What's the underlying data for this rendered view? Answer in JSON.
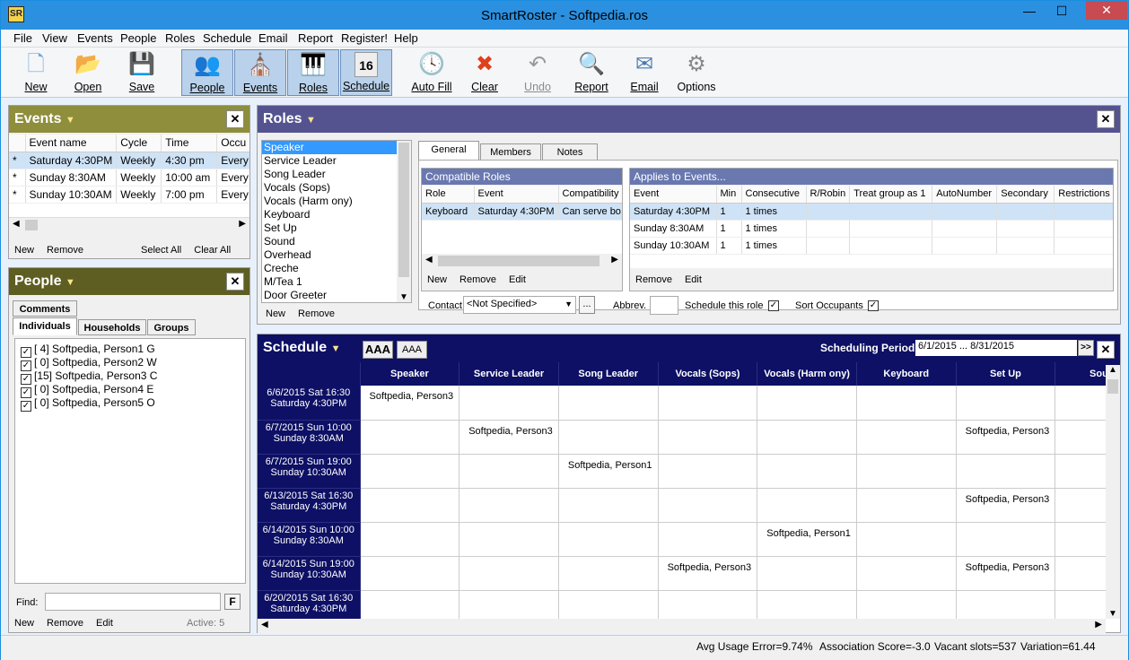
{
  "app": {
    "title": "SmartRoster - Softpedia.ros",
    "icon_text": "SR"
  },
  "menu": [
    "File",
    "View",
    "Events",
    "People",
    "Roles",
    "Schedule",
    "Email",
    "Report",
    "Register!",
    "Help"
  ],
  "toolbar": [
    {
      "label": "New",
      "icon": "new-file-icon",
      "glyph": "🗋"
    },
    {
      "label": "Open",
      "icon": "open-folder-icon",
      "glyph": "📂"
    },
    {
      "label": "Save",
      "icon": "save-disk-icon",
      "glyph": "💾"
    },
    {
      "label": "People",
      "icon": "people-icon",
      "glyph": "👥"
    },
    {
      "label": "Events",
      "icon": "events-building-icon",
      "glyph": "⛪"
    },
    {
      "label": "Roles",
      "icon": "roles-piano-icon",
      "glyph": "🎹"
    },
    {
      "label": "Schedule",
      "icon": "schedule-calendar-icon",
      "glyph": "16"
    },
    {
      "label": "Auto Fill",
      "icon": "clock-icon",
      "glyph": "🕓"
    },
    {
      "label": "Clear",
      "icon": "clear-x-icon",
      "glyph": "✖"
    },
    {
      "label": "Undo",
      "icon": "undo-icon",
      "glyph": "↶"
    },
    {
      "label": "Report",
      "icon": "report-icon",
      "glyph": "🔍"
    },
    {
      "label": "Email",
      "icon": "email-icon",
      "glyph": "✉"
    },
    {
      "label": "Options",
      "icon": "gear-icon",
      "glyph": "⚙"
    }
  ],
  "events": {
    "title": "Events",
    "headers": [
      "Event name",
      "Cycle",
      "Time",
      "Occu"
    ],
    "rows": [
      [
        "*",
        "Saturday 4:30PM",
        "Weekly",
        "4:30 pm",
        "Every"
      ],
      [
        "*",
        "Sunday 8:30AM",
        "Weekly",
        "10:00 am",
        "Every"
      ],
      [
        "*",
        "Sunday 10:30AM",
        "Weekly",
        "7:00 pm",
        "Every"
      ]
    ],
    "actions": [
      "New",
      "Remove",
      "Select All",
      "Clear All"
    ]
  },
  "people": {
    "title": "People",
    "tabs": [
      "Comments",
      "Individuals",
      "Households",
      "Groups"
    ],
    "items": [
      "[ 4] Softpedia, Person1 G",
      "[ 0] Softpedia, Person2 W",
      "[15] Softpedia, Person3 C",
      "[ 0] Softpedia, Person4 E",
      "[ 0] Softpedia, Person5 O"
    ],
    "find_label": "Find:",
    "find_button": "F",
    "actions": [
      "New",
      "Remove",
      "Edit"
    ],
    "active": "Active: 5"
  },
  "roles": {
    "title": "Roles",
    "list": [
      "Speaker",
      "Service Leader",
      "Song Leader",
      "Vocals (Sops)",
      "Vocals (Harm ony)",
      "Keyboard",
      "Set Up",
      "Sound",
      "Overhead",
      "Creche",
      "M/Tea 1",
      "Door Greeter"
    ],
    "list_actions": [
      "New",
      "Remove"
    ],
    "tabs": [
      "General",
      "Members",
      "Notes"
    ],
    "compat_title": "Compatible Roles",
    "compat_headers": [
      "Role",
      "Event",
      "Compatibility"
    ],
    "compat_rows": [
      [
        "Keyboard",
        "Saturday 4:30PM",
        "Can serve bo"
      ]
    ],
    "compat_actions": [
      "New",
      "Remove",
      "Edit"
    ],
    "applies_title": "Applies to Events...",
    "applies_headers": [
      "Event",
      "Min",
      "Consecutive",
      "R/Robin",
      "Treat group as 1",
      "AutoNumber",
      "Secondary",
      "Restrictions"
    ],
    "applies_rows": [
      [
        "Saturday 4:30PM",
        "1",
        "1 times"
      ],
      [
        "Sunday 8:30AM",
        "1",
        "1 times"
      ],
      [
        "Sunday 10:30AM",
        "1",
        "1 times"
      ]
    ],
    "applies_actions": [
      "Remove",
      "Edit"
    ],
    "contact_label": "Contact",
    "contact_value": "<Not Specified>",
    "abbrev_label": "Abbrev.",
    "schedule_role_label": "Schedule this role",
    "sort_occupants_label": "Sort Occupants"
  },
  "schedule": {
    "title": "Schedule",
    "font_buttons": [
      "AAA",
      "AAA"
    ],
    "period_label": "Scheduling Period",
    "period_value": "6/1/2015 ... 8/31/2015",
    "period_go": ">>",
    "columns": [
      "Speaker",
      "Service Leader",
      "Song Leader",
      "Vocals (Sops)",
      "Vocals (Harm ony)",
      "Keyboard",
      "Set Up",
      "Sound"
    ],
    "rows": [
      {
        "date": "6/6/2015 Sat 16:30",
        "event": "Saturday 4:30PM",
        "cells": [
          "Softpedia, Person3",
          "",
          "",
          "",
          "",
          "",
          "",
          ""
        ]
      },
      {
        "date": "6/7/2015 Sun 10:00",
        "event": "Sunday 8:30AM",
        "cells": [
          "",
          "Softpedia, Person3",
          "",
          "",
          "",
          "",
          "Softpedia, Person3",
          ""
        ]
      },
      {
        "date": "6/7/2015 Sun 19:00",
        "event": "Sunday 10:30AM",
        "cells": [
          "",
          "",
          "Softpedia, Person1",
          "",
          "",
          "",
          "",
          ""
        ]
      },
      {
        "date": "6/13/2015 Sat 16:30",
        "event": "Saturday 4:30PM",
        "cells": [
          "",
          "",
          "",
          "",
          "",
          "",
          "Softpedia, Person3",
          ""
        ]
      },
      {
        "date": "6/14/2015 Sun 10:00",
        "event": "Sunday 8:30AM",
        "cells": [
          "",
          "",
          "",
          "",
          "Softpedia, Person1",
          "",
          "",
          ""
        ]
      },
      {
        "date": "6/14/2015 Sun 19:00",
        "event": "Sunday 10:30AM",
        "cells": [
          "",
          "",
          "",
          "Softpedia, Person3",
          "",
          "",
          "Softpedia, Person3",
          ""
        ]
      },
      {
        "date": "6/20/2015 Sat 16:30",
        "event": "Saturday 4:30PM",
        "cells": [
          "",
          "",
          "",
          "",
          "",
          "",
          "",
          ""
        ]
      }
    ]
  },
  "status": {
    "avg": "Avg Usage Error=9.74%",
    "assoc": "Association Score=-3.0",
    "vacant": "Vacant slots=537",
    "variation": "Variation=61.44"
  }
}
